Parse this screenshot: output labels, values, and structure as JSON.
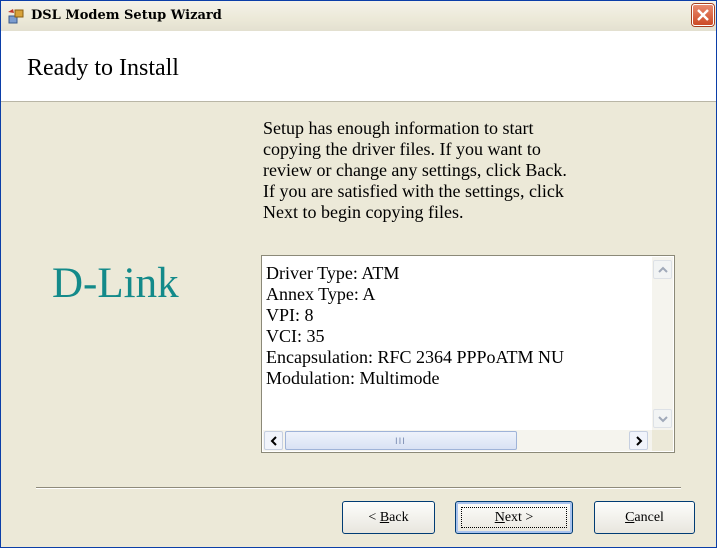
{
  "window": {
    "title": "DSL Modem Setup Wizard"
  },
  "header": {
    "title": "Ready to Install"
  },
  "branding": {
    "logo_text": "D-Link",
    "logo_color": "#138a8a"
  },
  "description": "Setup has enough information to start\ncopying the driver files.  If you want to\nreview or change any settings, click Back.\nIf you are satisfied with the settings, click\nNext to begin copying files.",
  "summary": {
    "lines": [
      "Driver Type: ATM",
      "Annex Type: A",
      "VPI: 8",
      "VCI: 35",
      "Encapsulation: RFC 2364 PPPoATM NU",
      "Modulation: Multimode"
    ],
    "hscroll_grip": "III"
  },
  "buttons": {
    "back": {
      "prefix": "< ",
      "mnemonic": "B",
      "rest": "ack"
    },
    "next": {
      "mnemonic": "N",
      "rest": "ext >"
    },
    "cancel": {
      "mnemonic": "C",
      "rest": "ancel"
    }
  },
  "icons": {
    "app": "wizard-app-icon",
    "close": "close-icon"
  }
}
